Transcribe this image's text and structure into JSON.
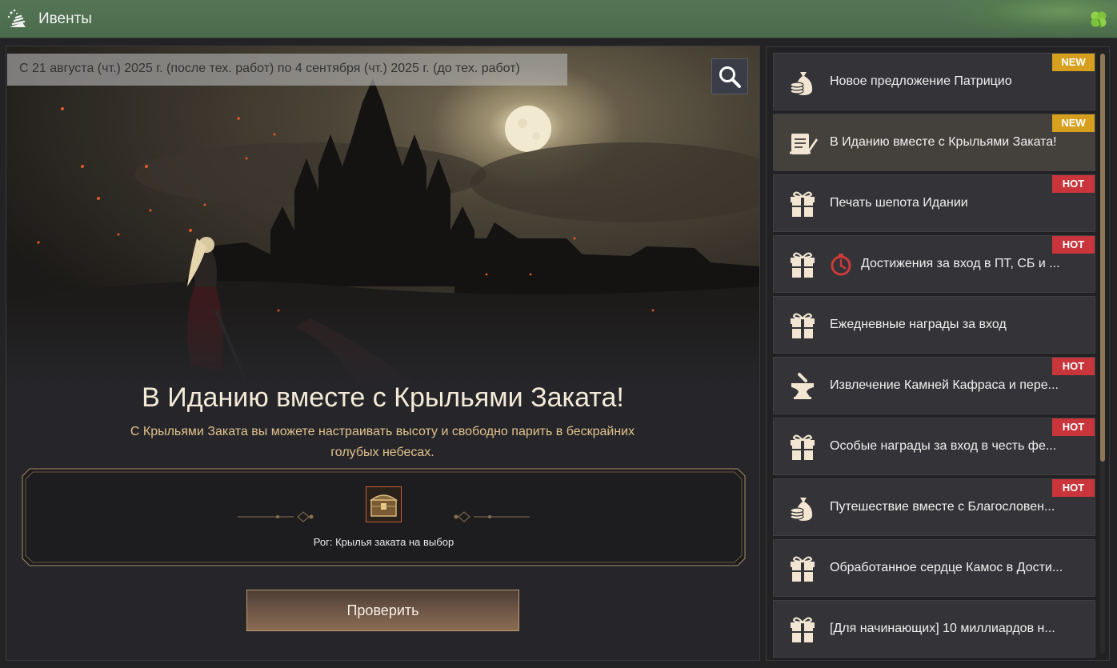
{
  "window": {
    "title": "Ивенты"
  },
  "event": {
    "period": "С 21 августа (чт.) 2025 г. (после тех. работ) по 4 сентября (чт.) 2025 г. (до тех. работ)",
    "title": "В Иданию вместе с Крыльями Заката!",
    "description": "С Крыльями Заката вы можете настраивать высоту и свободно парить в бескрайних голубых небесах.",
    "reward_label": "Рог: Крылья заката на выбор",
    "check_button": "Проверить"
  },
  "events_list": [
    {
      "label": "Новое предложение Патрицио",
      "badge": "NEW",
      "icon": "money-bag-icon",
      "active": false
    },
    {
      "label": "В Иданию вместе с Крыльями Заката!",
      "badge": "NEW",
      "icon": "scroll-quill-icon",
      "active": true
    },
    {
      "label": "Печать шепота Идании",
      "badge": "HOT",
      "icon": "gift-icon",
      "active": false
    },
    {
      "label": "Достижения за вход в ПТ, СБ и ...",
      "badge": "HOT",
      "icon": "gift-icon",
      "timer": true,
      "active": false
    },
    {
      "label": "Ежедневные награды за вход",
      "badge": "",
      "icon": "gift-icon",
      "active": false
    },
    {
      "label": "Извлечение Камней Кафраса и пере...",
      "badge": "HOT",
      "icon": "anvil-icon",
      "active": false
    },
    {
      "label": "Особые награды за вход в честь фе...",
      "badge": "HOT",
      "icon": "gift-icon",
      "active": false
    },
    {
      "label": "Путешествие вместе с Благословен...",
      "badge": "HOT",
      "icon": "money-bag-icon",
      "active": false
    },
    {
      "label": "Обработанное сердце Камос в Дости...",
      "badge": "",
      "icon": "gift-icon",
      "active": false
    },
    {
      "label": "[Для начинающих] 10 миллиардов н...",
      "badge": "",
      "icon": "gift-icon",
      "active": false
    }
  ],
  "colors": {
    "titlebar": "#4f6f51",
    "new_badge": "#d6a01e",
    "hot_badge": "#c8363c",
    "accent_gold": "#e2c28c"
  }
}
